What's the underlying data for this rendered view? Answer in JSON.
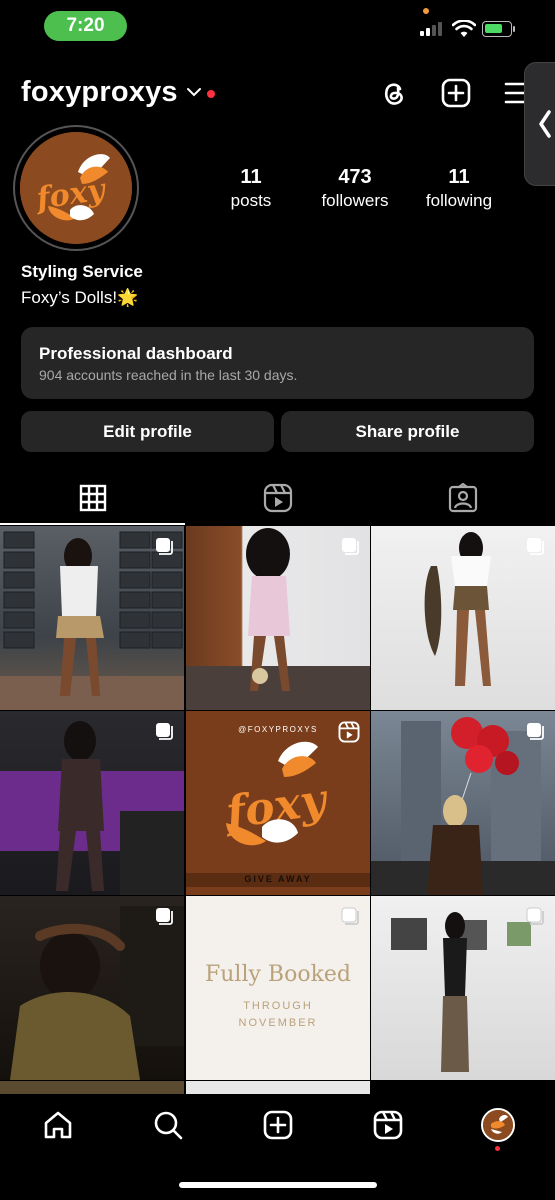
{
  "status": {
    "time": "7:20"
  },
  "profile": {
    "username": "foxyproxys",
    "posts": {
      "count": "11",
      "label": "posts"
    },
    "followers": {
      "count": "473",
      "label": "followers"
    },
    "following": {
      "count": "11",
      "label": "following"
    },
    "name": "Styling Service",
    "bio": "Foxy’s Dolls!🌟"
  },
  "dashboard": {
    "title": "Professional dashboard",
    "subtitle": "904 accounts reached in the last 30 days."
  },
  "buttons": {
    "edit": "Edit profile",
    "share": "Share profile"
  },
  "tabs": [
    "grid-icon",
    "reels-icon",
    "tagged-icon"
  ],
  "posts": {
    "giveaway_handle": "@FOXYPROXYS",
    "giveaway_logo": "foxy",
    "giveaway_caption": "GIVE AWAY",
    "booked_title": "Fully Booked",
    "booked_line1": "THROUGH",
    "booked_line2": "NOVEMBER"
  },
  "nav": [
    "home-icon",
    "search-icon",
    "create-icon",
    "reels-icon",
    "profile-avatar"
  ],
  "colors": {
    "accent": "#4cbf4f",
    "brand": "#8b4a1f",
    "orange": "#f08a2c",
    "notification": "#ff3040"
  }
}
